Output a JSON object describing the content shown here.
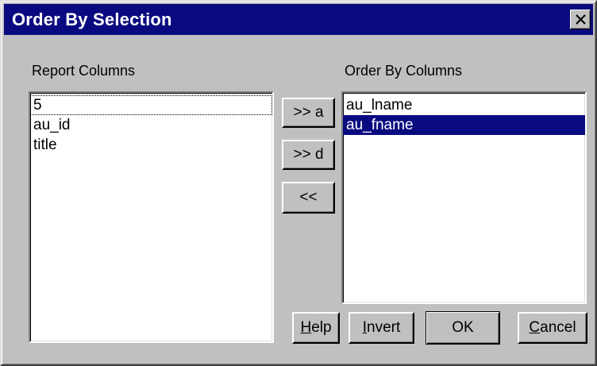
{
  "dialog": {
    "title": "Order By Selection"
  },
  "report_columns": {
    "label": "Report Columns",
    "items": [
      "5",
      "au_id",
      "title"
    ],
    "focused_index": 0
  },
  "order_by_columns": {
    "label": "Order By Columns",
    "items": [
      "au_lname",
      "au_fname"
    ],
    "selected_index": 1
  },
  "move_buttons": {
    "ascending": ">> a",
    "descending": ">> d",
    "remove": "<<"
  },
  "action_buttons": {
    "help": {
      "accel": "H",
      "rest": "elp"
    },
    "invert": {
      "accel": "I",
      "rest": "nvert"
    },
    "ok": "OK",
    "cancel": {
      "accel": "C",
      "rest": "ancel"
    }
  },
  "colors": {
    "titlebar": "#0a0a80",
    "face": "#c0c0c0",
    "selection": "#0a0a80"
  }
}
